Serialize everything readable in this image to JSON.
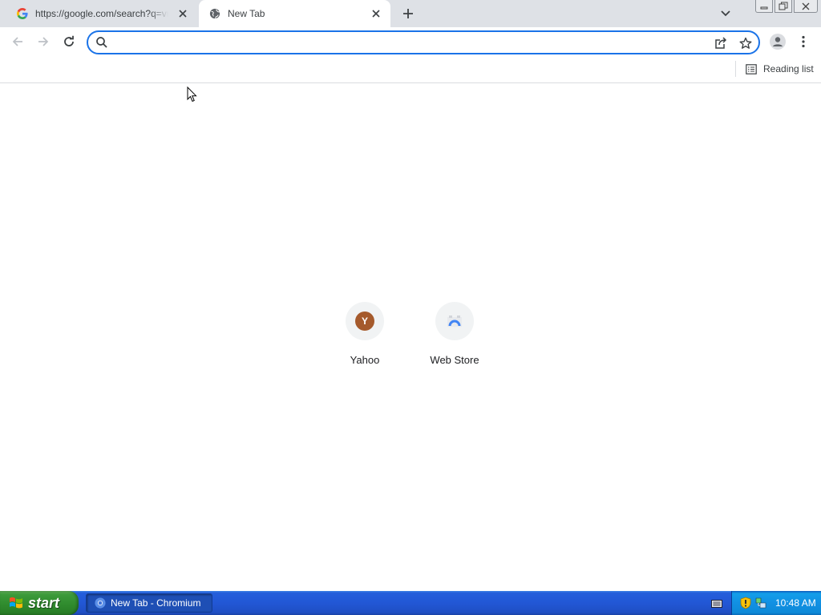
{
  "tabs": [
    {
      "title": "https://google.com/search?q=vmware",
      "favicon": "google-g-icon",
      "active": false
    },
    {
      "title": "New Tab",
      "favicon": "globe-icon",
      "active": true
    }
  ],
  "toolbar": {
    "omnibox_value": "",
    "omnibox_placeholder": ""
  },
  "bookmarks_bar": {
    "reading_list_label": "Reading list"
  },
  "shortcuts": [
    {
      "title": "Yahoo",
      "icon_letter": "Y",
      "icon": "yahoo-letter-icon"
    },
    {
      "title": "Web Store",
      "icon": "web-store-icon"
    }
  ],
  "taskbar": {
    "start_label": "start",
    "task_item_label": "New Tab - Chromium",
    "clock": "10:48 AM"
  },
  "colors": {
    "accent": "#1a73e8",
    "tabstrip": "#dee1e6",
    "yahoo_badge": "#a55a2c",
    "taskbar_blue": "#245edb",
    "start_green": "#3c9a3a"
  }
}
